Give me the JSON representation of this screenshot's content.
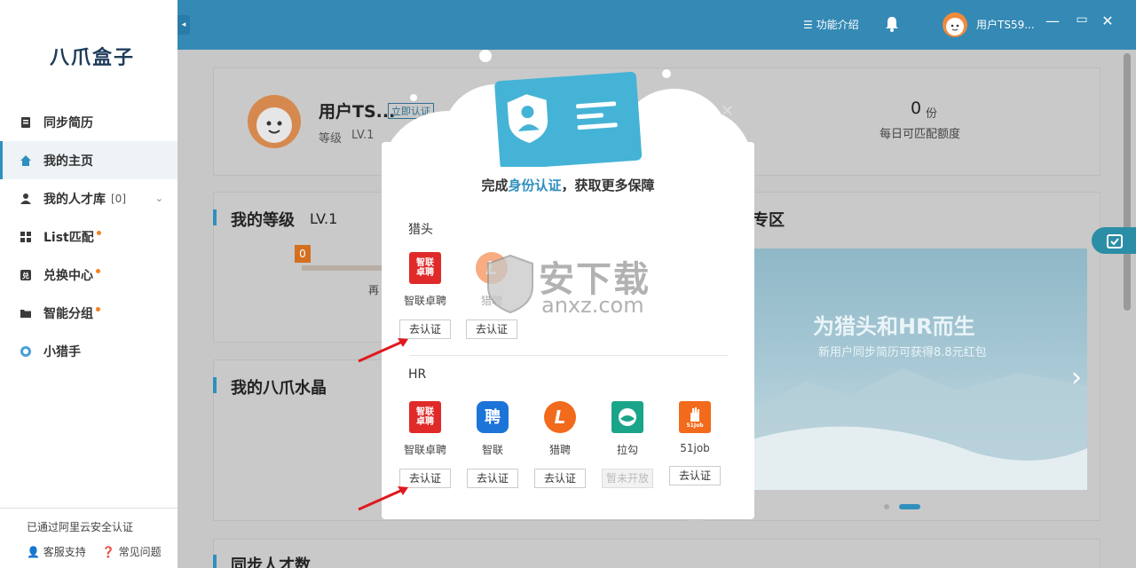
{
  "app": {
    "brand": "八爪盒子"
  },
  "sidebar": {
    "items": [
      {
        "label": "同步简历",
        "icon": "resume-sync-icon"
      },
      {
        "label": "我的主页",
        "icon": "home-icon",
        "active": true
      },
      {
        "label": "我的人才库",
        "count": "[0]",
        "icon": "user-icon"
      },
      {
        "label": "List匹配",
        "icon": "grid-icon",
        "dot": true
      },
      {
        "label": "兑换中心",
        "icon": "exchange-icon",
        "dot": true
      },
      {
        "label": "智能分组",
        "icon": "folder-icon",
        "dot": true
      },
      {
        "label": "小猎手",
        "icon": "hunter-icon"
      }
    ],
    "footer": {
      "security": "已通过阿里云安全认证",
      "support": "客服支持",
      "faq": "常见问题"
    }
  },
  "topbar": {
    "intro": "功能介绍",
    "username": "用户TS59..."
  },
  "profile": {
    "name": "用户TS...",
    "verify": "立即认证",
    "level_label": "等级",
    "level": "LV.1",
    "quota_value": "0",
    "quota_unit": "份",
    "quota_label": "每日可匹配额度"
  },
  "sections": {
    "level_title": "我的等级",
    "level_value": "LV.1",
    "level_marker": "0",
    "level_partial": "再",
    "crystal_title": "我的八爪水晶",
    "zone_partial": "专区",
    "sync_title": "同步人才数"
  },
  "banner": {
    "title": "为猎头和HR而生",
    "subtitle": "新用户同步简历可获得8.8元红包"
  },
  "modal": {
    "heading_pre": "完成",
    "heading_hl": "身份认证",
    "heading_post": "，获取更多保障",
    "headhunter_label": "猎头",
    "hr_label": "HR",
    "headhunter": [
      {
        "name": "智联卓聘",
        "button": "去认证",
        "logo_text": "智联卓聘",
        "color": "#e02a2a"
      },
      {
        "name": "猎聘",
        "button": "去认证",
        "logo_text": "L",
        "color": "#f26a1b"
      }
    ],
    "hr": [
      {
        "name": "智联卓聘",
        "button": "去认证",
        "logo_text": "智联卓聘",
        "color": "#e02a2a"
      },
      {
        "name": "智联",
        "button": "去认证",
        "logo_text": "聘",
        "color": "#1d74d8"
      },
      {
        "name": "猎聘",
        "button": "去认证",
        "logo_text": "L",
        "color": "#f26a1b"
      },
      {
        "name": "拉勾",
        "button": "暂未开放",
        "logo_text": "",
        "color": "#1aa58a",
        "disabled": true
      },
      {
        "name": "51job",
        "button": "去认证",
        "logo_text": "51Job",
        "color": "#f26a1b"
      }
    ]
  },
  "watermark": {
    "text": "安下载",
    "sub": "anxz.com"
  }
}
